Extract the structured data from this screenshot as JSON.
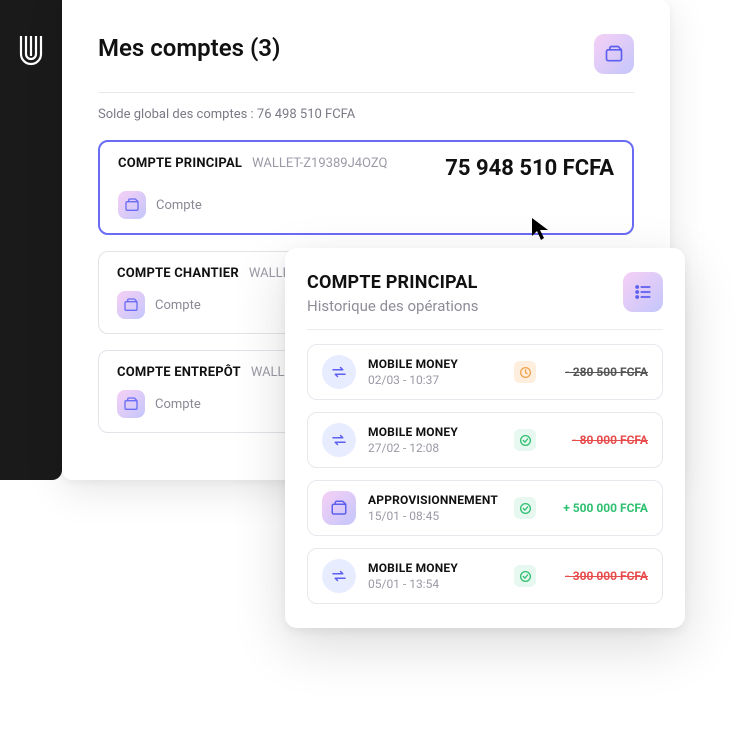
{
  "header": {
    "title": "Mes comptes (3)"
  },
  "global_balance_line": "Solde global des comptes : 76 498 510 FCFA",
  "accounts": [
    {
      "name": "COMPTE PRINCIPAL",
      "wallet_id": "WALLET-Z19389J4OZQ",
      "type": "Compte",
      "amount": "75 948 510 FCFA",
      "selected": true
    },
    {
      "name": "COMPTE CHANTIER",
      "wallet_id": "WALLET-",
      "type": "Compte",
      "amount": "",
      "selected": false
    },
    {
      "name": "COMPTE ENTREPÔT",
      "wallet_id": "WALLET-",
      "type": "Compte",
      "amount": "",
      "selected": false
    }
  ],
  "history": {
    "title": "COMPTE PRINCIPAL",
    "subtitle": "Historique des opérations",
    "transactions": [
      {
        "label": "MOBILE MONEY",
        "date": "02/03 - 10:37",
        "status": "pending",
        "amount": "- 280 500 FCFA",
        "direction": "out",
        "icon": "transfer"
      },
      {
        "label": "MOBILE MONEY",
        "date": "27/02 - 12:08",
        "status": "ok",
        "amount": "- 80 000 FCFA",
        "direction": "out",
        "icon": "transfer"
      },
      {
        "label": "APPROVISIONNEMENT",
        "date": "15/01 - 08:45",
        "status": "ok",
        "amount": "+ 500 000 FCFA",
        "direction": "in",
        "icon": "wallet"
      },
      {
        "label": "MOBILE MONEY",
        "date": "05/01 - 13:54",
        "status": "ok",
        "amount": "- 300 000 FCFA",
        "direction": "out",
        "icon": "transfer"
      }
    ]
  }
}
